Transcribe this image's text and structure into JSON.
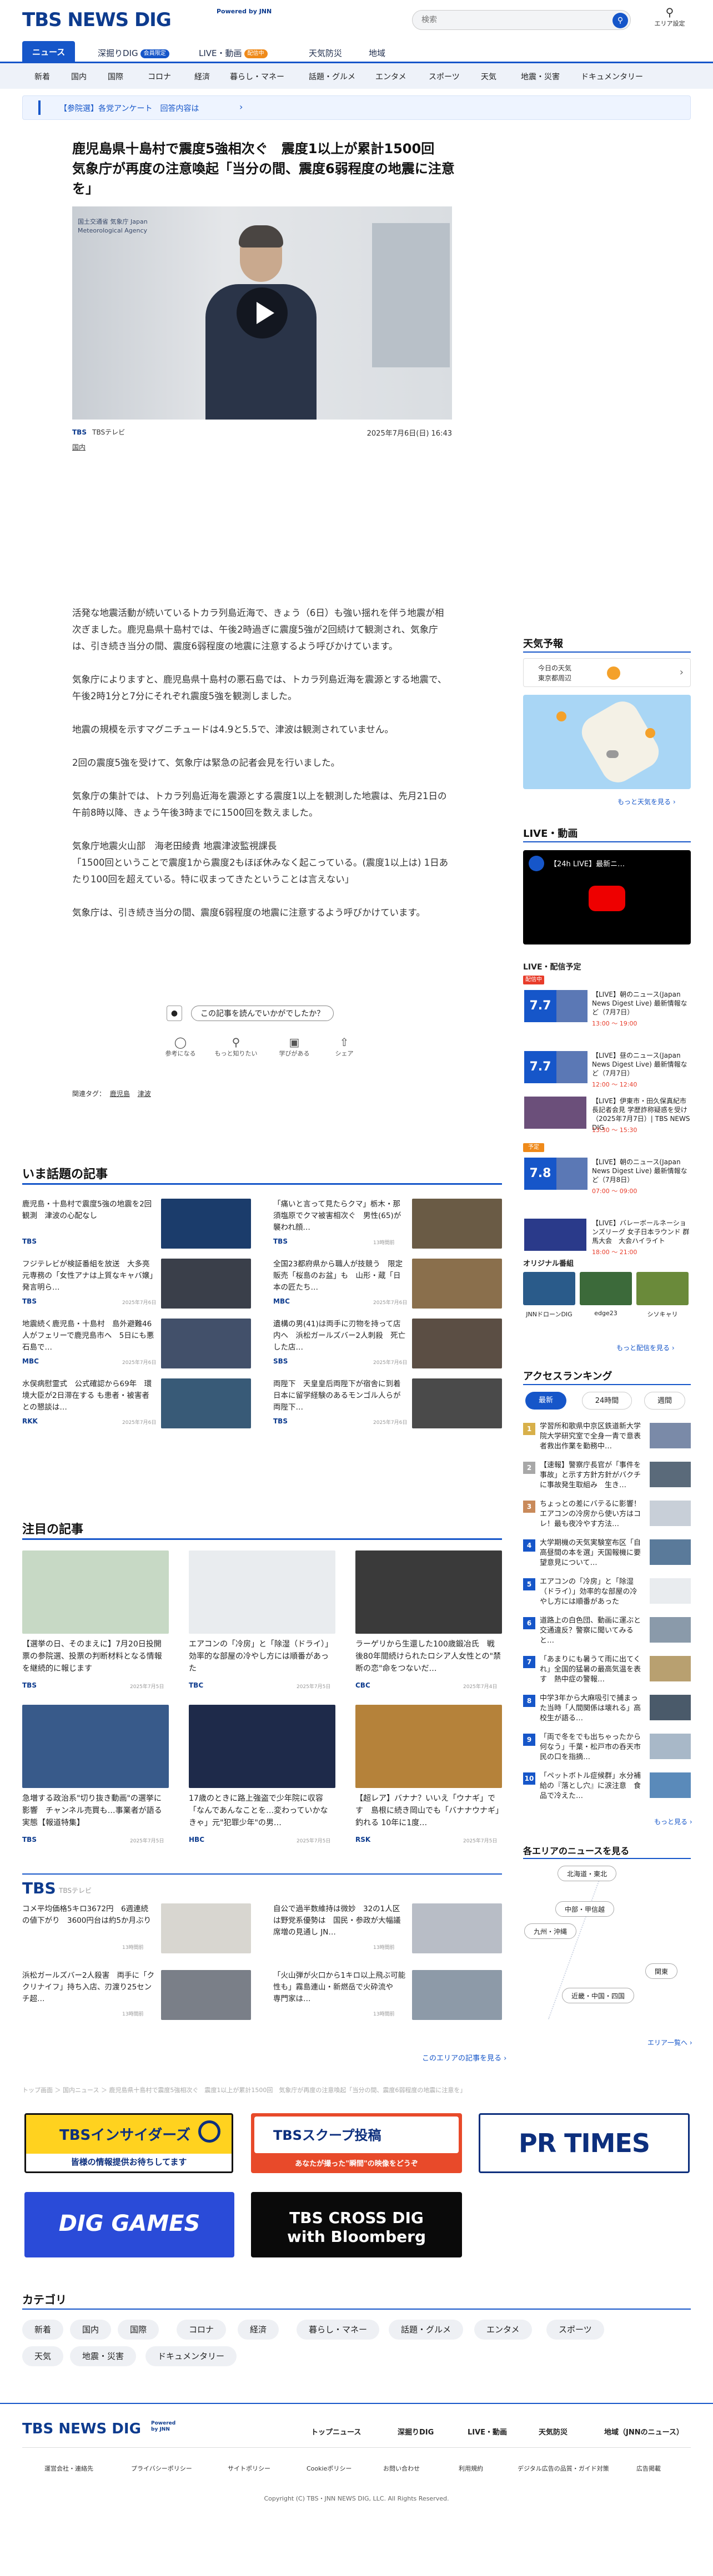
{
  "header": {
    "logo": "TBS NEWS DIG",
    "powered": "Powered by JNN",
    "search_placeholder": "検索",
    "area_label": "エリア設定"
  },
  "nav_main": [
    {
      "label": "ニュース"
    },
    {
      "label": "深掘りDIG",
      "badge": "会員限定"
    },
    {
      "label": "LIVE・動画",
      "badge": "配信中"
    },
    {
      "label": "天気防災"
    },
    {
      "label": "地域"
    }
  ],
  "nav_categories": [
    "新着",
    "国内",
    "国際",
    "コロナ",
    "経済",
    "暮らし・マネー",
    "話題・グルメ",
    "エンタメ",
    "スポーツ",
    "天気",
    "地震・災害",
    "ドキュメンタリー"
  ],
  "notice": {
    "text": "【参院選】各党アンケート　回答内容は",
    "arrow": "›"
  },
  "article": {
    "title": "鹿児島県十島村で震度5強相次ぐ　震度1以上が累計1500回　気象庁が再度の注意喚起「当分の間、震度6弱程度の地震に注意を」",
    "video_sign": "国土交通省 気象庁 Japan Meteorological Agency",
    "source": "TBSテレビ",
    "datetime": "2025年7月6日(日) 16:43",
    "category": "国内",
    "paragraphs": [
      "活発な地震活動が続いているトカラ列島近海で、きょう（6日）も強い揺れを伴う地震が相次ぎました。鹿児島県十島村では、午後2時過ぎに震度5強が2回続けて観測され、気象庁は、引き続き当分の間、震度6弱程度の地震に注意するよう呼びかけています。",
      "気象庁によりますと、鹿児島県十島村の悪石島では、トカラ列島近海を震源とする地震で、午後2時1分と7分にそれぞれ震度5強を観測しました。",
      "地震の規模を示すマグニチュードは4.9と5.5で、津波は観測されていません。",
      "2回の震度5強を受けて、気象庁は緊急の記者会見を行いました。",
      "気象庁の集計では、トカラ列島近海を震源とする震度1以上を観測した地震は、先月21日の午前8時以降、きょう午後3時までに1500回を数えました。",
      "気象庁地震火山部　海老田綾貴 地震津波監視課長\n「1500回ということで震度1から震度2もほぼ休みなく起こっている。(震度1以上は) 1日あたり100回を超えている。特に収まってきたということは言えない」",
      "気象庁は、引き続き当分の間、震度6弱程度の地震に注意するよう呼びかけています。"
    ],
    "feedback_q": "この記事を読んでいかがでしたか？",
    "feedback": [
      "参考になる",
      "もっと知りたい",
      "学びがある",
      "シェア"
    ],
    "tags_label": "関連タグ：",
    "tags": [
      "鹿児島",
      "津波"
    ]
  },
  "hot": {
    "title": "いま話題の記事",
    "items": [
      {
        "title": "鹿児島・十島村で震度5強の地震を2回観測　津波の心配なし",
        "src": "TBS",
        "date": ""
      },
      {
        "title": "「痛いと言って見たらクマ」栃木・那須塩原でクマ被害相次ぐ　男性(65)が襲われ顔…",
        "src": "TBS",
        "date": "13時間前"
      },
      {
        "title": "フジテレビが検証番組を放送　大多亮元専務の「女性アナは上質なキャバ嬢」発言明ら…",
        "src": "TBS",
        "date": "2025年7月6日"
      },
      {
        "title": "全国23都府県から職人が技競う　限定販売「桜島のお盆」も　山形・蔵「日本の匠たち…",
        "src": "MBC",
        "date": "2025年7月6日"
      },
      {
        "title": "地震続く鹿児島・十島村　島外避難46人がフェリーで鹿児島市へ　5日にも悪石島で…",
        "src": "MBC",
        "date": "2025年7月6日"
      },
      {
        "title": "遺構の男(41)は両手に刃物を持って店内へ　浜松ガールズバー2人刺殺　死亡した店…",
        "src": "SBS",
        "date": "2025年7月6日"
      },
      {
        "title": "水俣病慰霊式　公式確認から69年　環境大臣が2日滞在する も患者・被害者との懇談は…",
        "src": "RKK",
        "date": "2025年7月6日"
      },
      {
        "title": "両陛下　天皇皇后両陛下が宿舎に到着　日本に留学経験のあるモンゴル人らが両陛下…",
        "src": "TBS",
        "date": "2025年7月6日"
      }
    ]
  },
  "featured": {
    "title": "注目の記事",
    "items": [
      {
        "title": "【選挙の日、そのまえに】7月20日投開票の参院選、投票の判断材料となる情報を継続的に報じます",
        "src": "TBS",
        "date": "2025年7月5日"
      },
      {
        "title": "エアコンの「冷房」と「除湿（ドライ）」効率的な部屋の冷やし方には順番があった",
        "src": "TBC",
        "date": "2025年7月5日"
      },
      {
        "title": "ラーゲリから生還した100歳鍛冶氏　戦後80年間続けられたロシア人女性との\"禁断の恋\"命をつないだ…",
        "src": "CBC",
        "date": "2025年7月4日"
      },
      {
        "title": "急増する政治系\"切り抜き動画\"の選挙に影響　チャンネル売買も…事業者が語る実態【報道特集】",
        "src": "TBS",
        "date": "2025年7月5日"
      },
      {
        "title": "17歳のときに路上強盗で少年院に収容「なんであんなことを…変わっていかなきゃ」元\"犯罪少年\"の男…",
        "src": "HBC",
        "date": "2025年7月5日"
      },
      {
        "title": "【超レア】バナナ？いいえ「ウナギ」です　島根に続き岡山でも「バナナウナギ」釣れる 10年に1度…",
        "src": "RSK",
        "date": "2025年7月5日"
      }
    ]
  },
  "tbs_box": {
    "label": "TBSテレビ",
    "items": [
      {
        "title": "コメ平均価格5キロ3672円　6週連続の値下がり　3600円台は約5か月ぶり",
        "date": "13時間前"
      },
      {
        "title": "自公で過半数維持は微妙　32の1人区は野党系優勢は　国民・参政が大幅議席増の見通し JN…",
        "date": "13時間前"
      },
      {
        "title": "浜松ガールズバー2人殺害　両手に「ククリナイフ」持ち入店、刃渡り25センチ超…",
        "date": "13時間前"
      },
      {
        "title": "「火山弾が火口から1キロ以上飛ぶ可能性も」霧島連山・新燃岳で火砕流や　専門家は…",
        "date": "13時間前"
      }
    ],
    "more": "このエリアの記事を見る ›"
  },
  "breadcrumb": "トップ画面 ＞ 国内ニュース ＞ 鹿児島県十島村で震度5強相次ぐ　震度1以上が累計1500回　気象庁が再度の注意喚起「当分の間、震度6弱程度の地震に注意を」",
  "banners": [
    "TBSインサイダーズ",
    "TBSスクープ投稿",
    "PR TIMES",
    "DIG GAMES",
    "TBS CROSS DIG with Bloomberg"
  ],
  "banner_sub": {
    "insiders": "皆様の情報提供お待ちしてます",
    "scoop": "あなたが撮った\"瞬間\"の映像をどうぞ"
  },
  "category_section": {
    "title": "カテゴリ",
    "chips": [
      "新着",
      "国内",
      "国際",
      "コロナ",
      "経済",
      "暮らし・マネー",
      "話題・グルメ",
      "エンタメ",
      "スポーツ",
      "天気",
      "地震・災害",
      "ドキュメンタリー"
    ]
  },
  "sidebar": {
    "weather_title": "天気予報",
    "weather_today": "今日の天気",
    "weather_region": "東京都周辺",
    "weather_more": "もっと天気を見る ›",
    "live_title": "LIVE・動画",
    "live_video_title": "【24h LIVE】最新ニ…",
    "schedule_title": "LIVE・配信予定",
    "schedule": [
      {
        "tag": "配信中",
        "date": "7.7",
        "tag_color": "#e83c2a",
        "title": "【LIVE】朝のニュース(Japan News Digest Live) 最新情報など（7月7日）",
        "time": "13:00 〜 19:00"
      },
      {
        "tag": "",
        "date": "7.7",
        "tag_color": "",
        "title": "【LIVE】昼のニュース(Japan News Digest Live) 最新情報など（7月7日）",
        "time": "12:00 〜 12:40"
      },
      {
        "tag": "",
        "date": "",
        "tag_color": "",
        "title": "【LIVE】伊東市・田久保真紀市長記者会見 学歴詐称疑惑を受け（2025年7月7日）| TBS NEWS DIG",
        "time": "13:30 〜 15:30"
      },
      {
        "tag": "予定",
        "date": "7.8",
        "tag_color": "#ef8a1a",
        "title": "【LIVE】朝のニュース(Japan News Digest Live) 最新情報など（7月8日）",
        "time": "07:00 〜 09:00"
      },
      {
        "tag": "",
        "date": "",
        "tag_color": "",
        "title": "【LIVE】バレーボールネーションズリーグ 女子日本ラウンド 群馬大会　大会ハイライト",
        "time": "18:00 〜 21:00"
      }
    ],
    "original_title": "オリジナル番組",
    "originals": [
      "JNNドローンDIG",
      "edge23",
      "シソキャリ"
    ],
    "schedule_more": "もっと配信を見る ›",
    "ranking_title": "アクセスランキング",
    "ranking_tabs": [
      "最新",
      "24時間",
      "週間"
    ],
    "ranking": [
      "学習所和歌県中京区鉄道新大学院大学研究室で全身一青で意表者救出作業を勤務中…",
      "【速報】警察庁長官が「事件を事故」と示す方針方針がバクチに事故発生取組み　生き…",
      "ちょっとの差にバテるに影響！エアコンの冷房から使い方はコレ！最も夜冷やす方法…",
      "大学期機の天気実験室布区「自高昼間の本を選」天国報機に要望意見について…",
      "エアコンの「冷房」と「除湿（ドライ）」効率的な部屋の冷やし方には順番があった",
      "道路上の白色団、動画に運ぶと交通違反？警察に聞いてみると…",
      "「あまりにも暑うて雨に出てくれ」全国的猛暑の最高気温を表す　熱中症の警報…",
      "中学3年から大麻吸引で捕まった当時「人間関係は壊れる」高校生が語る…",
      "「両で冬をでも出ちゃったから何なう」千葉・松戸市の呑天市民の口を指摘…",
      "「ペットボトル症候群」水分補給の『落とし穴』に涙注意　食品で冷えた…"
    ],
    "ranking_more": "もっと見る ›",
    "area_title": "各エリアのニュースを見る",
    "areas": [
      "北海道・東北",
      "中部・甲信越",
      "九州・沖縄",
      "関東",
      "近畿・中国・四国"
    ],
    "area_more": "エリア一覧へ ›"
  },
  "footer": {
    "logo": "TBS NEWS DIG",
    "powered": "Powered by JNN",
    "nav": [
      "トップニュース",
      "深掘りDIG",
      "LIVE・動画",
      "天気防災",
      "地域（JNNのニュース）"
    ],
    "links": [
      "運営会社・連絡先",
      "プライバシーポリシー",
      "サイトポリシー",
      "Cookieポリシー",
      "お問い合わせ",
      "利用規約",
      "デジタル広告の品質・ガイド対策",
      "広告掲載"
    ],
    "copyright": "Copyright (C) TBS・JNN NEWS DIG, LLC. All Rights Reserved."
  }
}
